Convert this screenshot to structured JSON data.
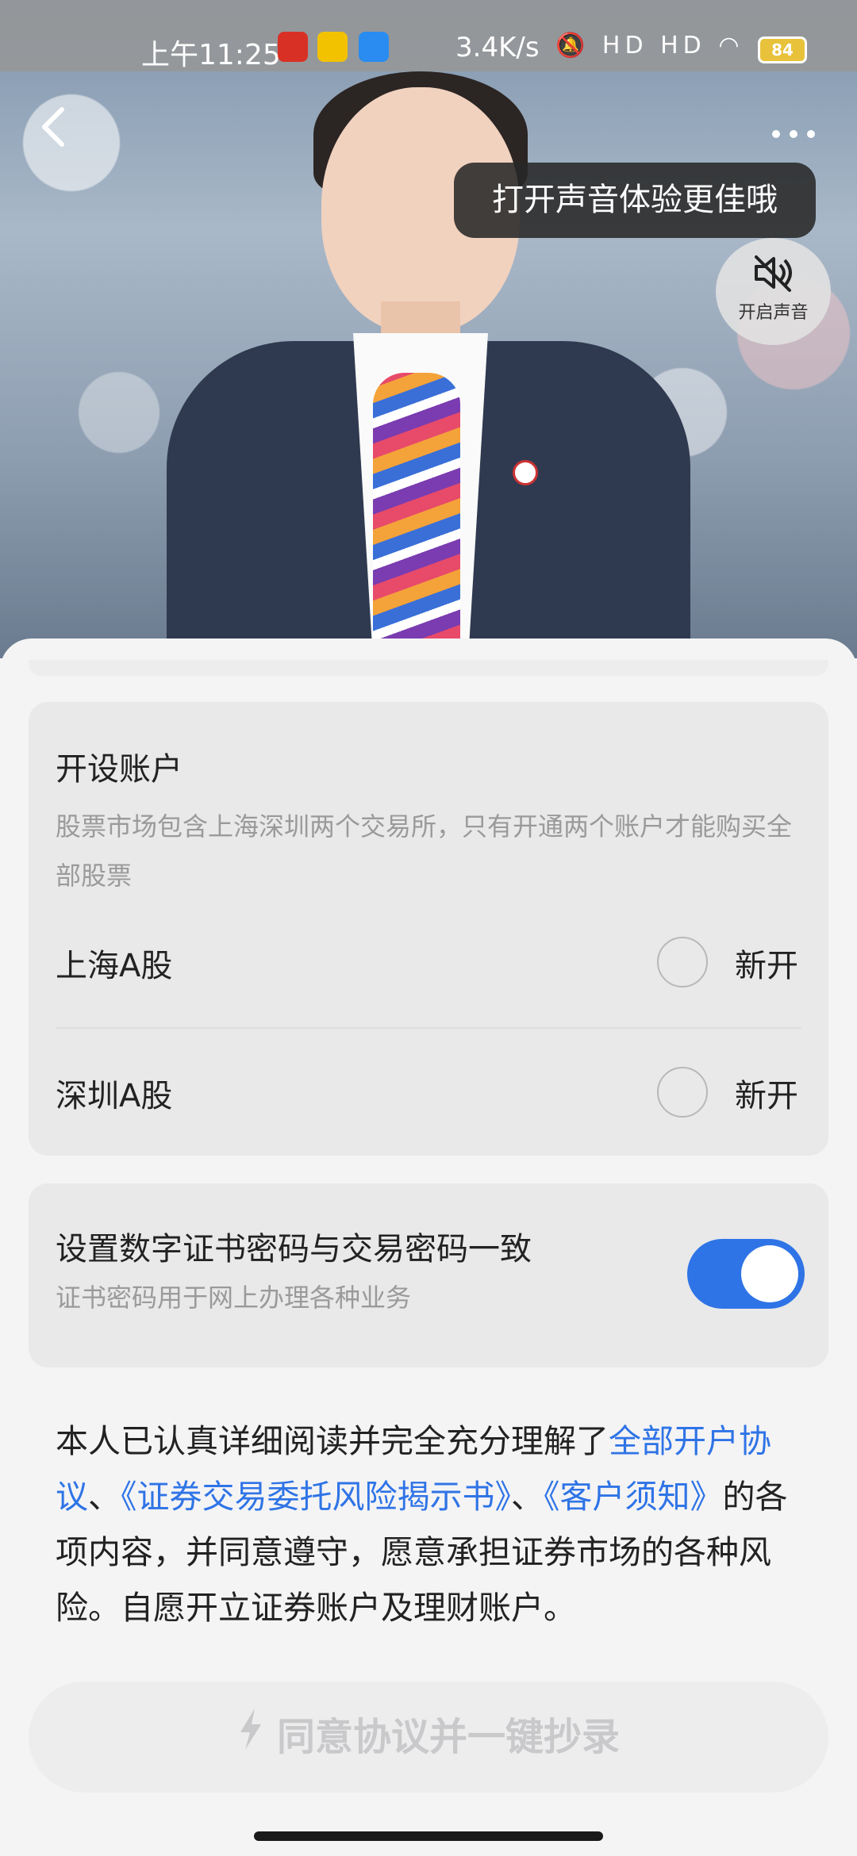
{
  "status_bar": {
    "time": "上午11:25",
    "speed": "3.4K/s",
    "network_icons": "HD HD",
    "battery": "84"
  },
  "header": {
    "back_icon": "chevron-left-icon",
    "more_icon": "more-dots-icon"
  },
  "video": {
    "tooltip": "打开声音体验更佳哦",
    "sound_button_label": "开启声音",
    "sound_icon": "speaker-muted-icon"
  },
  "account_card": {
    "title": "开设账户",
    "description": "股票市场包含上海深圳两个交易所，只有开通两个账户才能购买全部股票",
    "rows": [
      {
        "label": "上海A股",
        "status": "新开"
      },
      {
        "label": "深圳A股",
        "status": "新开"
      }
    ]
  },
  "password_card": {
    "title": "设置数字证书密码与交易密码一致",
    "subtitle": "证书密码用于网上办理各种业务",
    "toggle_on": true
  },
  "agreement": {
    "prefix": "本人已认真详细阅读并完全充分理解了",
    "link1": "全部开户协议",
    "sep1": "、",
    "link2": "《证券交易委托风险揭示书》",
    "sep2": "、",
    "link3": "《客户须知》",
    "suffix": "的各项内容，并同意遵守，愿意承担证券市场的各种风险。自愿开立证券账户及理财账户。"
  },
  "cta": {
    "label": "同意协议并一键抄录",
    "icon": "lightning-icon"
  },
  "colors": {
    "accent": "#2f74e6",
    "card_bg": "#e9e9ea",
    "disabled_text": "#c9c9cb"
  }
}
